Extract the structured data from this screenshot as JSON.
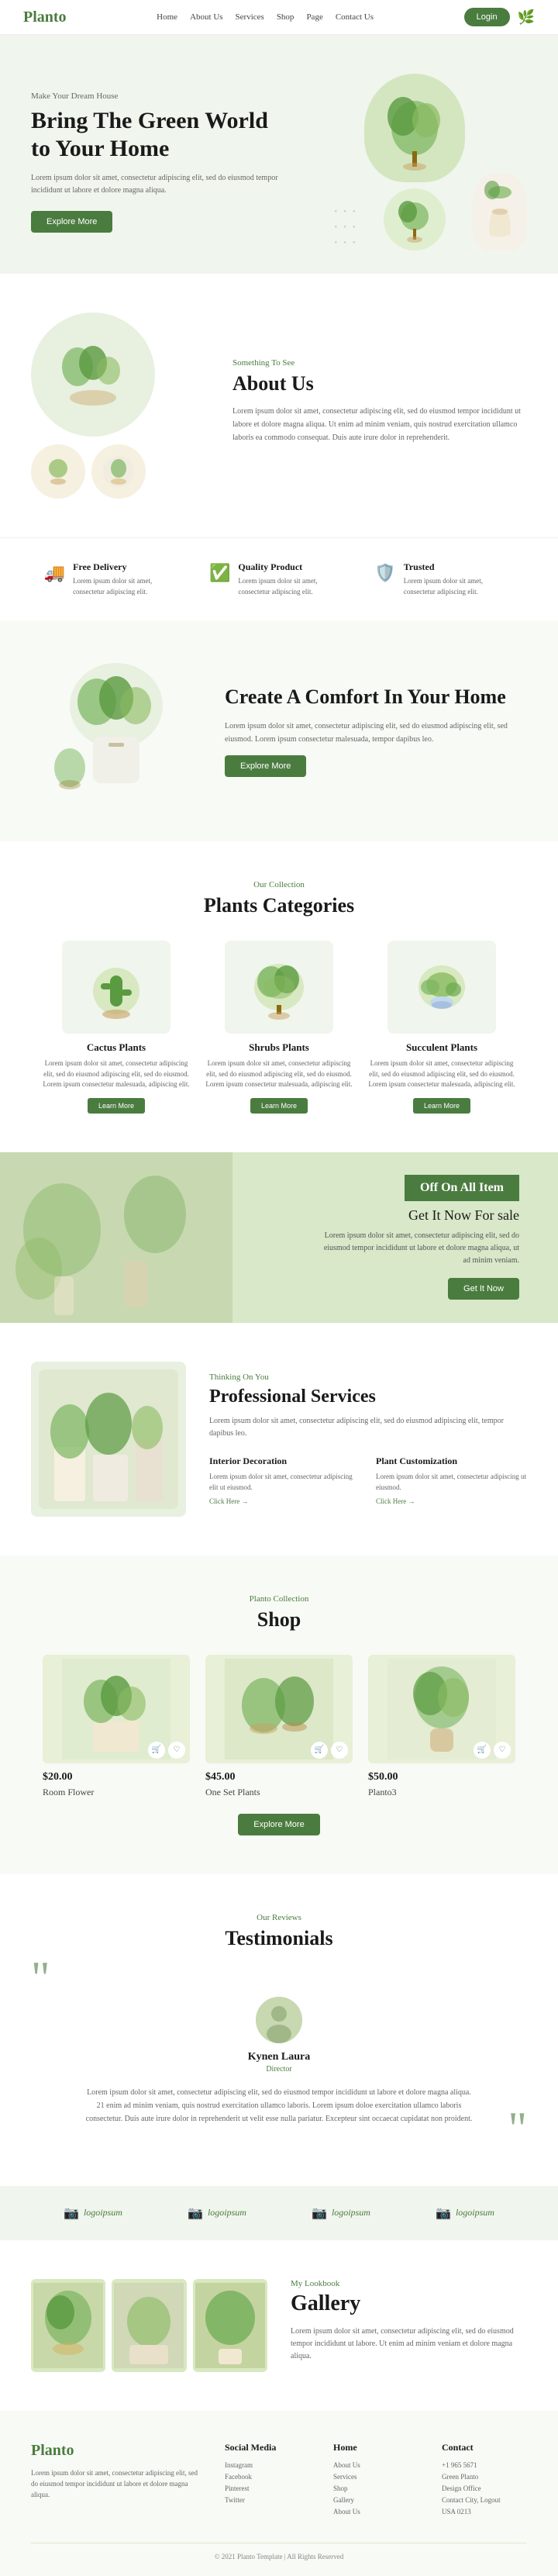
{
  "nav": {
    "logo": "Planto",
    "links": [
      "Home",
      "About Us",
      "Services",
      "Shop",
      "Page",
      "Contact Us"
    ],
    "login_label": "Login",
    "leaf_icon": "🌿"
  },
  "hero": {
    "sub": "Make Your Dream House",
    "title": "Bring The Green World to Your Home",
    "desc": "Lorem ipsum dolor sit amet, consectetur adipiscing elit, sed do eiusmod tempor incididunt ut labore et dolore magna aliqua.",
    "btn": "Explore More"
  },
  "about": {
    "sub": "Something To See",
    "title": "About Us",
    "desc": "Lorem ipsum dolor sit amet, consectetur adipiscing elit, sed do eiusmod tempor incididunt ut labore et dolore magna aliqua. Ut enim ad minim veniam, quis nostrud exercitation ullamco laboris ea commodo consequat. Duis aute irure dolor in reprehenderit."
  },
  "features": [
    {
      "icon": "🚚",
      "title": "Free Delivery",
      "desc": "Lorem ipsum dolor sit amet, consectetur adipiscing elit."
    },
    {
      "icon": "✅",
      "title": "Quality Product",
      "desc": "Lorem ipsum dolor sit amet, consectetur adipiscing elit."
    },
    {
      "icon": "🛡️",
      "title": "Trusted",
      "desc": "Lorem ipsum dolor sit amet, consectetur adipiscing elit."
    }
  ],
  "comfort": {
    "title": "Create A Comfort In Your Home",
    "desc": "Lorem ipsum dolor sit amet, consectetur adipiscing elit, sed do eiusmod adipiscing elit, sed eiusmod. Lorem ipsum consectetur malesuada, tempor dapibus leo.",
    "btn": "Explore More"
  },
  "categories": {
    "sub": "Our Collection",
    "title": "Plants Categories",
    "items": [
      {
        "name": "Cactus Plants",
        "desc": "Lorem ipsum dolor sit amet, consectetur adipiscing elit, sed do eiusmod adipiscing elit, sed do eiusmod. Lorem ipsum consectetur malesuada, adipiscing elit.",
        "btn": "Learn More"
      },
      {
        "name": "Shrubs Plants",
        "desc": "Lorem ipsum dolor sit amet, consectetur adipiscing elit, sed do eiusmod adipiscing elit, sed do eiusmod. Lorem ipsum consectetur malesuada, adipiscing elit.",
        "btn": "Learn More"
      },
      {
        "name": "Succulent Plants",
        "desc": "Lorem ipsum dolor sit amet, consectetur adipiscing elit, sed do eiusmod adipiscing elit, sed do eiusmod. Lorem ipsum consectetur malesuada, adipiscing elit.",
        "btn": "Learn More"
      }
    ]
  },
  "sale": {
    "badge": "Off On All Item",
    "subtitle": "Get It Now For sale",
    "desc": "Lorem ipsum dolor sit amet, consectetur adipiscing elit, sed do eiusmod tempor incididunt ut labore et dolore magna aliqua, ut ad minim veniam.",
    "btn": "Get It Now"
  },
  "services": {
    "sub": "Thinking On You",
    "title": "Professional Services",
    "desc": "Lorem ipsum dolor sit amet, consectetur adipiscing elit, sed do eiusmod adipiscing elit, tempor dapibus leo.",
    "items": [
      {
        "name": "Interior Decoration",
        "desc": "Lorem ipsum dolor sit amet, consectetur adipiscing elit ut eiusmod.",
        "link": "Click Here →"
      },
      {
        "name": "Plant Customization",
        "desc": "Lorem ipsum dolor sit amet, consectetur adipiscing ut eiusmod.",
        "link": "Click Here →"
      }
    ]
  },
  "shop": {
    "sub": "Planto Collection",
    "title": "Shop",
    "items": [
      {
        "price": "$20.00",
        "name": "Room Flower"
      },
      {
        "price": "$45.00",
        "name": "One Set Plants"
      },
      {
        "price": "$50.00",
        "name": "Planto3"
      }
    ],
    "btn": "Explore More"
  },
  "testimonials": {
    "sub": "Our Reviews",
    "title": "Testimonials",
    "name": "Kynen Laura",
    "role": "Director",
    "text": "Lorem ipsum dolor sit amet, consectetur adipiscing elit, sed do eiusmod tempor incididunt ut labore et dolore magna aliqua. 21 enim ad minim veniam, quis nostrud exercitation ullamco laboris. Lorem ipsum doloe exercitation ullamco laboris consectetur. Duis aute irure dolor in reprehenderit ut velit esse nulla pariatur. Excepteur sint occaecat cupidatat non proident."
  },
  "logos": [
    {
      "icon": "📷",
      "text": "logoipsum"
    },
    {
      "icon": "📷",
      "text": "logoipsum"
    },
    {
      "icon": "📷",
      "text": "logoipsum"
    },
    {
      "icon": "📷",
      "text": "logoipsum"
    }
  ],
  "gallery": {
    "sub": "My Lookbook",
    "title": "Gallery",
    "desc": "Lorem ipsum dolor sit amet, consectetur adipiscing elit, sed do eiusmod tempor incididunt ut labore. Ut enim ad minim veniam et dolore magna aliqua."
  },
  "footer": {
    "logo": "Planto",
    "desc": "Lorem ipsum dolor sit amet, consectetur adipiscing elit, sed do eiusmod tempor incididunt ut labore et dolore magna aliqua.",
    "social_title": "Social Media",
    "social_links": [
      "Instagram",
      "Facebook",
      "Pinterest",
      "Twitter"
    ],
    "home_title": "Home",
    "home_links": [
      "About Us",
      "Services",
      "Shop",
      "Gallery",
      "About Us"
    ],
    "contact_title": "Contact",
    "contact_info": [
      "+1 965 5671",
      "Green Planto",
      "Design Office",
      "Contact City, Logout",
      "USA 0213"
    ],
    "copyright": "© 2021 Planto Template | All Rights Reserved"
  },
  "colors": {
    "green": "#4a7c3f",
    "light_green_bg": "#f0f5ed",
    "medium_green": "#c8d8b0"
  }
}
